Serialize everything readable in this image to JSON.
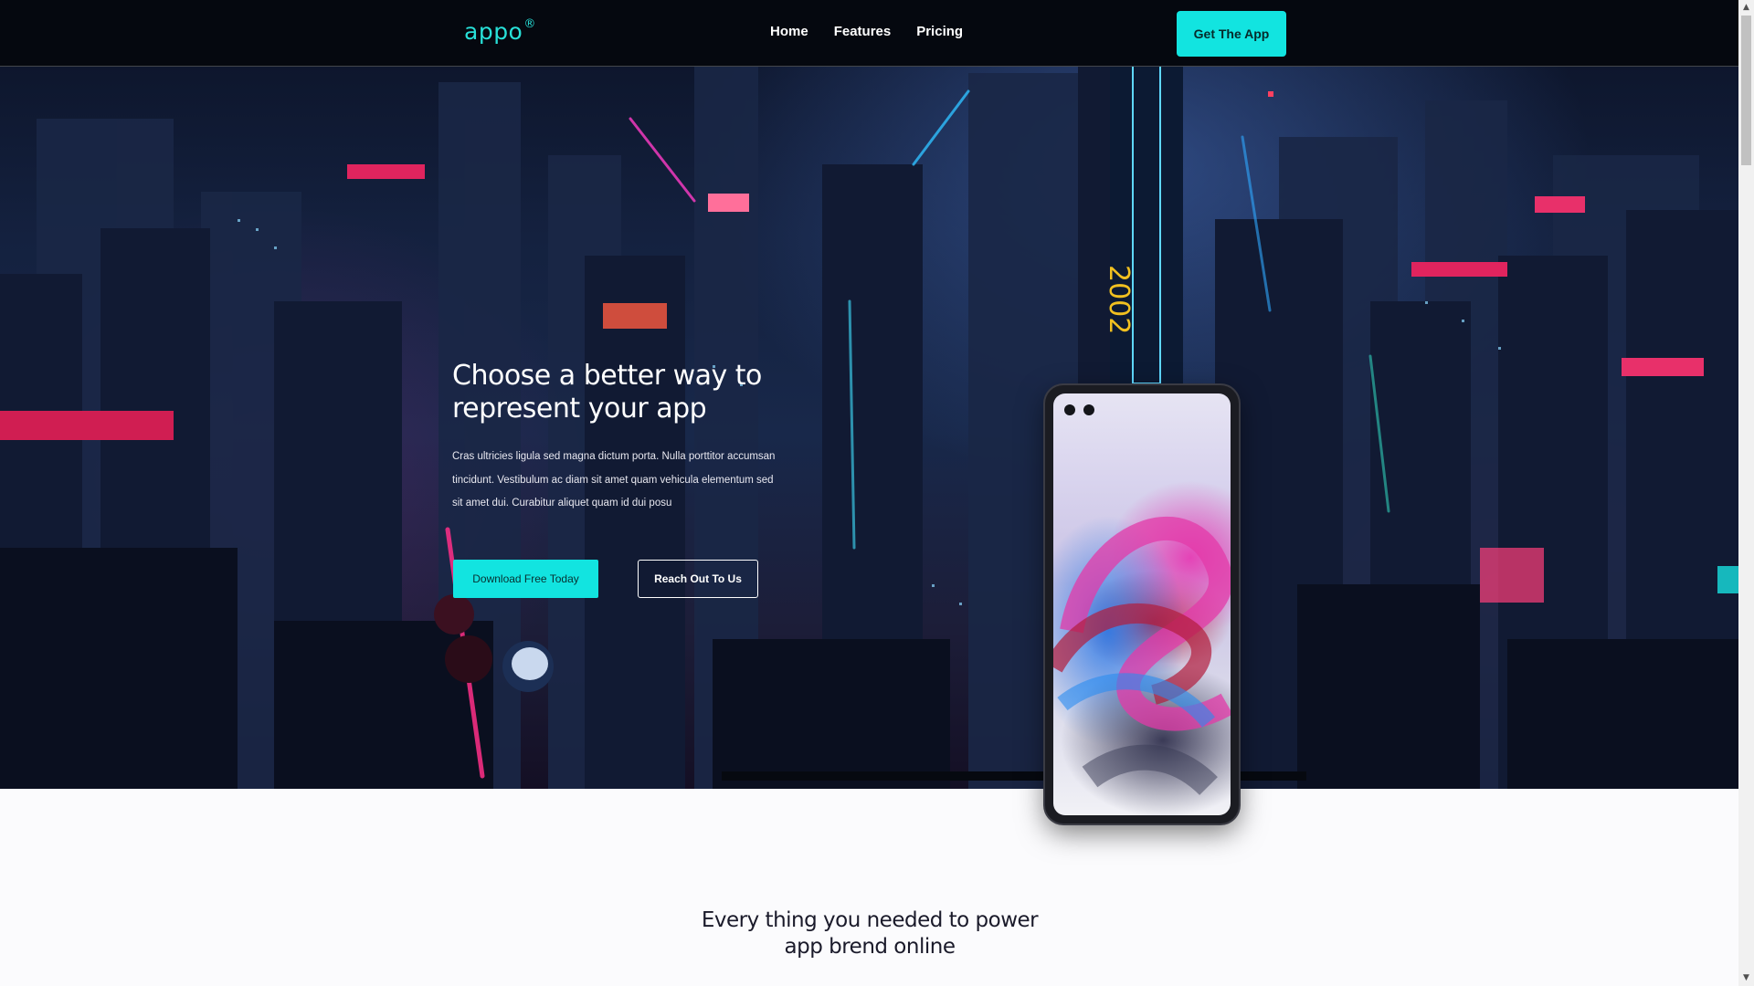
{
  "header": {
    "logo_text": "appo",
    "logo_mark": "®",
    "nav": [
      {
        "label": "Home"
      },
      {
        "label": "Features"
      },
      {
        "label": "Pricing"
      }
    ],
    "cta_label": "Get The App"
  },
  "hero": {
    "title": "Choose a better way to represent your app",
    "text": "Cras ultricies ligula sed magna dictum porta. Nulla porttitor accumsan tincidunt. Vestibulum ac diam sit amet quam vehicula elementum sed sit amet dui. Curabitur aliquet quam id dui posu",
    "primary_button": "Download Free Today",
    "secondary_button": "Reach Out To Us"
  },
  "features": {
    "title": "Every thing you needed to power app brend online"
  },
  "colors": {
    "accent": "#12e4e0",
    "logo": "#28e0d8",
    "header_bg": "#05080f"
  },
  "icons": {
    "phone": "phone-mockup-icon",
    "scroll_up": "scroll-up-arrow-icon",
    "scroll_down": "scroll-down-arrow-icon"
  }
}
